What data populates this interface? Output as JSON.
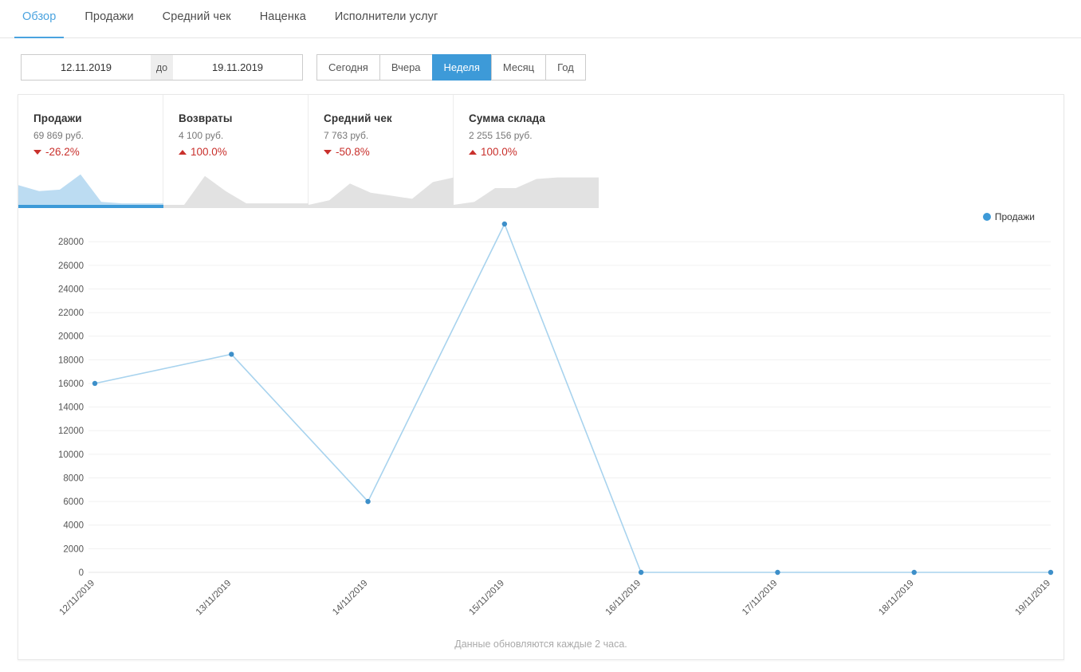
{
  "tabs": [
    {
      "label": "Обзор",
      "active": true
    },
    {
      "label": "Продажи",
      "active": false
    },
    {
      "label": "Средний чек",
      "active": false
    },
    {
      "label": "Наценка",
      "active": false
    },
    {
      "label": "Исполнители услуг",
      "active": false
    }
  ],
  "toolbar": {
    "date_from": "12.11.2019",
    "date_to": "19.11.2019",
    "separator": "до",
    "periods": [
      {
        "label": "Сегодня",
        "active": false
      },
      {
        "label": "Вчера",
        "active": false
      },
      {
        "label": "Неделя",
        "active": true
      },
      {
        "label": "Месяц",
        "active": false
      },
      {
        "label": "Год",
        "active": false
      }
    ]
  },
  "kpis": [
    {
      "title": "Продажи",
      "value": "69 869 руб.",
      "delta": "-26.2%",
      "direction": "down",
      "active": true,
      "spark": [
        26,
        18,
        20,
        40,
        4,
        2,
        2,
        2
      ]
    },
    {
      "title": "Возвраты",
      "value": "4 100 руб.",
      "delta": "100.0%",
      "direction": "up",
      "active": false,
      "spark": [
        0,
        0,
        38,
        18,
        2,
        2,
        2,
        2
      ]
    },
    {
      "title": "Средний чек",
      "value": "7 763 руб.",
      "delta": "-50.8%",
      "direction": "down",
      "active": false,
      "spark": [
        0,
        6,
        28,
        16,
        12,
        8,
        30,
        36
      ]
    },
    {
      "title": "Сумма склада",
      "value": "2 255 156 руб.",
      "delta": "100.0%",
      "direction": "up",
      "active": false,
      "spark": [
        0,
        4,
        22,
        22,
        34,
        36,
        36,
        36
      ]
    }
  ],
  "chart_data": {
    "type": "line",
    "title": "",
    "xlabel": "",
    "ylabel": "",
    "grid": true,
    "legend_position": "top-right",
    "ylim": [
      0,
      29500
    ],
    "yticks": [
      0,
      2000,
      4000,
      6000,
      8000,
      10000,
      12000,
      14000,
      16000,
      18000,
      20000,
      22000,
      24000,
      26000,
      28000
    ],
    "categories": [
      "12/11/2019",
      "13/11/2019",
      "14/11/2019",
      "15/11/2019",
      "16/11/2019",
      "17/11/2019",
      "18/11/2019",
      "19/11/2019"
    ],
    "series": [
      {
        "name": "Продажи",
        "color": "#3d9ad8",
        "values": [
          16000,
          18470,
          6000,
          29500,
          0,
          0,
          0,
          0
        ]
      }
    ]
  },
  "legend": {
    "label": "Продажи"
  },
  "footnote": "Данные обновляются каждые 2 часа."
}
